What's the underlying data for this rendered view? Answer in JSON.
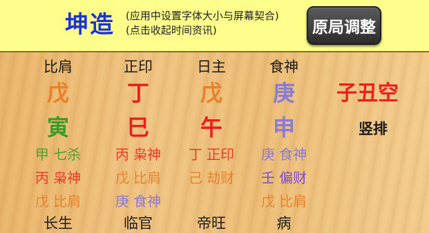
{
  "header": {
    "title": "坤造",
    "hint_line1": "(应用中设置字体大小与屏幕契合)",
    "hint_line2": "(点击收起时间资讯)",
    "adjust_button": "原局调整"
  },
  "pillars": [
    {
      "ten_god": "比肩",
      "stem": "戊",
      "stem_color": "#e8822a",
      "branch": "寅",
      "branch_color": "#3a9a2a",
      "hidden": [
        {
          "text": "甲 七杀",
          "color": "#4aa12e"
        },
        {
          "text": "丙 枭神",
          "color": "#e83a2a"
        },
        {
          "text": "戊 比肩",
          "color": "#e8822a"
        }
      ],
      "stage": "长生"
    },
    {
      "ten_god": "正印",
      "stem": "丁",
      "stem_color": "#ee1c1c",
      "branch": "巳",
      "branch_color": "#ee1c1c",
      "hidden": [
        {
          "text": "丙 枭神",
          "color": "#e83a2a"
        },
        {
          "text": "戊 比肩",
          "color": "#e8822a"
        },
        {
          "text": "庚 食神",
          "color": "#8a7ad8"
        }
      ],
      "stage": "临官"
    },
    {
      "ten_god": "日主",
      "stem": "戊",
      "stem_color": "#e8822a",
      "branch": "午",
      "branch_color": "#ee1c1c",
      "hidden": [
        {
          "text": "丁 正印",
          "color": "#e83a2a"
        },
        {
          "text": "己 劫财",
          "color": "#e8822a"
        },
        {
          "text": "",
          "color": "#000000"
        }
      ],
      "stage": "帝旺"
    },
    {
      "ten_god": "食神",
      "stem": "庚",
      "stem_color": "#8a7ad8",
      "branch": "申",
      "branch_color": "#8a7ad8",
      "hidden": [
        {
          "text": "庚 食神",
          "color": "#8a7ad8"
        },
        {
          "text": "壬 偏财",
          "color": "#7a4ad8"
        },
        {
          "text": "戊 比肩",
          "color": "#e8822a"
        }
      ],
      "stage": "病"
    }
  ],
  "void": "子丑空",
  "vertical_button": "竖排"
}
